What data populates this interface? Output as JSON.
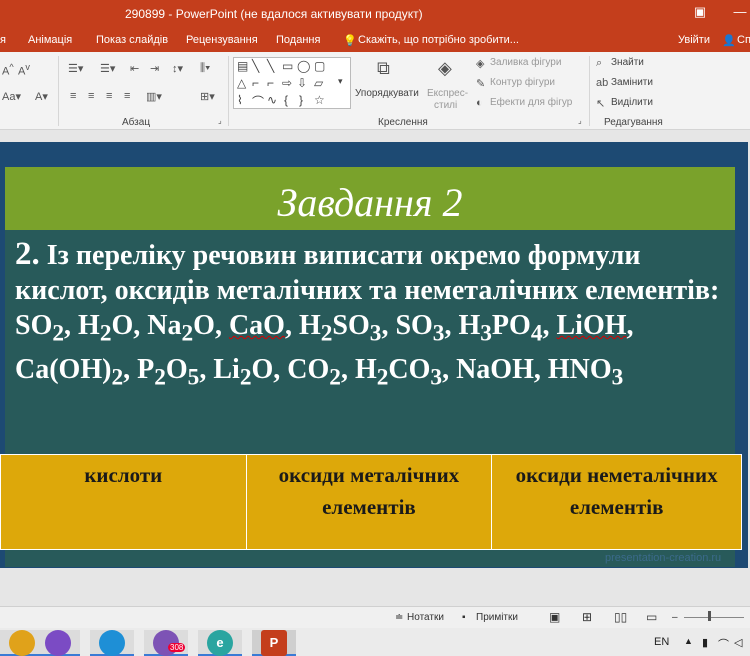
{
  "window": {
    "title": "290899 - PowerPoint (не вдалося активувати продукт)",
    "restore_icon": "restore-icon",
    "minimize_icon": "minimize-icon"
  },
  "tabs": [
    {
      "label": "я"
    },
    {
      "label": "Анімація"
    },
    {
      "label": "Показ слайдів"
    },
    {
      "label": "Рецензування"
    },
    {
      "label": "Подання"
    },
    {
      "label": "Скажіть, що потрібно зробити..."
    },
    {
      "label": "Увійти"
    },
    {
      "label": "Сп"
    }
  ],
  "ribbon": {
    "groups": {
      "paragraph": "Абзац",
      "drawing": "Креслення",
      "editing": "Редагування"
    },
    "arrange_label": "Упорядкувати",
    "quick_styles_line1": "Експрес-",
    "quick_styles_line2": "стилі",
    "shape_fill": "Заливка фігури",
    "shape_outline": "Контур фігури",
    "shape_effects": "Ефекти для фігур",
    "find": "Знайти",
    "replace": "Замінити",
    "select": "Виділити"
  },
  "slide": {
    "title": "Завдання 2",
    "task_number": "2.",
    "task_text_1": " Із переліку речовин виписати окремо формули кислот, оксидів металічних та неметалічних елементів: SO",
    "sub_2": "2",
    "task_text_h2o": ", H",
    "o": "O",
    "task_text_na2o": ", Na",
    "cao": "CaO",
    "h2so3_sub3": "3",
    "so3": "SO",
    "h3po4_h": "H",
    "po4": "PO",
    "sub_4": "4",
    "lioh": "LiOH",
    "caoh": "Ca(OH)",
    "p2o5_p": "P",
    "sub_5": "5",
    "li2o_li": "Li",
    "co2": "CO",
    "h2co3": "H",
    "co3": "CO",
    "naoh": "NaOH",
    "hno3": "HNO"
  },
  "table": {
    "headers": [
      "кислоти",
      "оксиди металічних елементів",
      "оксиди неметалічних елементів"
    ]
  },
  "watermark": "presentation-creation.ru",
  "statusbar": {
    "notes": "Нотатки",
    "comments": "Примітки"
  },
  "taskbar": {
    "lang": "EN",
    "viber_badge": "308",
    "apps": [
      {
        "icon": "chrome-icon",
        "color": "#e0a21a"
      },
      {
        "icon": "yandex-browser-icon",
        "color": "#7b4bc4"
      },
      {
        "icon": "edge-icon",
        "color": "#1e8fd6"
      },
      {
        "icon": "viber-icon",
        "color": "#7d53b5"
      },
      {
        "icon": "edge-legacy-icon",
        "color": "#2aa5a0"
      },
      {
        "icon": "powerpoint-icon",
        "color": "#c43e1c"
      }
    ]
  }
}
